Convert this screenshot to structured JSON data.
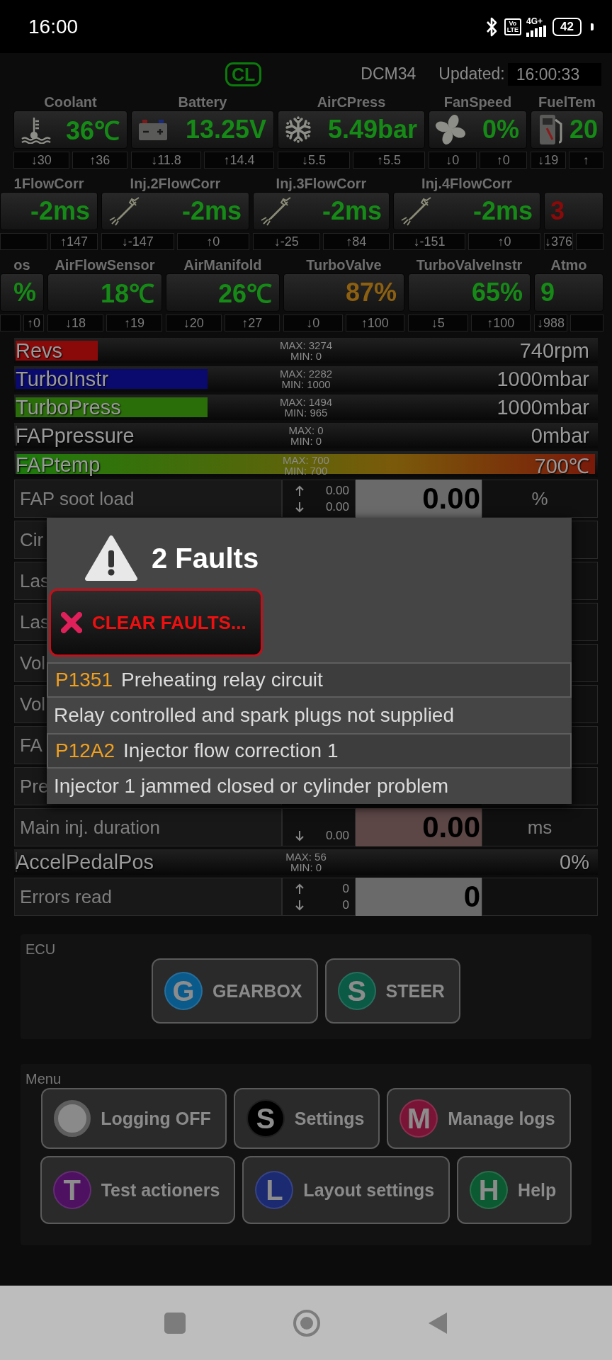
{
  "status_bar": {
    "time": "16:00",
    "volte": [
      "Vo",
      "LTE"
    ],
    "network": "4G+",
    "battery": "42"
  },
  "header": {
    "badge": "CL",
    "module": "DCM34",
    "updated_label": "Updated:",
    "updated_time": "16:00:33"
  },
  "gauge_rows": [
    {
      "tiles": [
        {
          "label": "Coolant",
          "value": "36℃",
          "warning": false,
          "alarm": false,
          "kind": "temperature",
          "min": "↓30",
          "max": "↑36"
        },
        {
          "label": "Battery",
          "value": "13.25V",
          "warning": false,
          "alarm": false,
          "kind": "battery",
          "min": "↓11.8",
          "max": "↑14.4"
        },
        {
          "label": "AirCPress",
          "value": "5.49bar",
          "warning": false,
          "alarm": false,
          "kind": "pressure",
          "min": "↓5.5",
          "max": "↑5.5"
        },
        {
          "label": "FanSpeed",
          "value": "0%",
          "warning": false,
          "alarm": false,
          "kind": "fan",
          "min": "↓0",
          "max": "↑0"
        },
        {
          "label": "FuelTem",
          "value": "20",
          "warning": false,
          "alarm": false,
          "kind": "fuel",
          "min": "↓19",
          "max": "↑"
        }
      ]
    },
    {
      "tiles": [
        {
          "label": "1FlowCorr",
          "value": "-2ms",
          "warning": false,
          "alarm": false,
          "kind": "plain",
          "max": "↑147"
        },
        {
          "label": "Inj.2FlowCorr",
          "value": "-2ms",
          "warning": false,
          "alarm": false,
          "kind": "injector",
          "min": "↓-147",
          "max": "↑0"
        },
        {
          "label": "Inj.3FlowCorr",
          "value": "-2ms",
          "warning": false,
          "alarm": false,
          "kind": "injector",
          "min": "↓-25",
          "max": "↑84"
        },
        {
          "label": "Inj.4FlowCorr",
          "value": "-2ms",
          "warning": false,
          "alarm": false,
          "kind": "injector",
          "min": "↓-151",
          "max": "↑0"
        },
        {
          "value": "3",
          "warning": false,
          "alarm": true,
          "kind": "plain",
          "min": "↓376"
        }
      ]
    },
    {
      "tiles": [
        {
          "label": "os",
          "value": "%",
          "warning": false,
          "alarm": false,
          "kind": "plain",
          "max": "↑0"
        },
        {
          "label": "AirFlowSensor",
          "value": "18℃",
          "warning": false,
          "alarm": false,
          "kind": "plain",
          "min": "↓18",
          "max": "↑19"
        },
        {
          "label": "AirManifold",
          "value": "26℃",
          "warning": false,
          "alarm": false,
          "kind": "plain",
          "min": "↓20",
          "max": "↑27"
        },
        {
          "label": "TurboValve",
          "value": "87%",
          "warning": true,
          "alarm": false,
          "kind": "plain",
          "min": "↓0",
          "max": "↑100"
        },
        {
          "label": "TurboValveInstr",
          "value": "65%",
          "warning": false,
          "alarm": false,
          "kind": "plain",
          "min": "↓5",
          "max": "↑100"
        },
        {
          "label": "Atmo",
          "value": "9",
          "warning": false,
          "alarm": false,
          "kind": "plain",
          "min": "↓988"
        }
      ]
    }
  ],
  "readouts": [
    {
      "kind": "bar",
      "label": "Revs",
      "max": "MAX: 3274",
      "min": "MIN: 0",
      "reading": "740rpm",
      "level": 0.14,
      "color": "#8a0a0a"
    },
    {
      "kind": "bar",
      "label": "TurboInstr",
      "max": "MAX: 2282",
      "min": "MIN: 1000",
      "reading": "1000mbar",
      "level": 0.33,
      "color": "#0a0a6e"
    },
    {
      "kind": "bar",
      "label": "TurboPress",
      "max": "MAX: 1494",
      "min": "MIN: 965",
      "reading": "1000mbar",
      "level": 0.33,
      "color": "#2a6e0a"
    },
    {
      "kind": "bar",
      "label": "FAPpressure",
      "max": "MAX: 0",
      "min": "MIN: 0",
      "reading": "0mbar",
      "level": 0
    },
    {
      "kind": "gradient",
      "label": "FAPtemp",
      "max": "MAX: 700",
      "min": "MIN: 700",
      "reading": "700℃",
      "level": 1
    },
    {
      "kind": "value",
      "label": "FAP soot load",
      "up": "0.00",
      "down": "0.00",
      "value": "0.00",
      "unit": "%",
      "alert": false
    },
    {
      "kind": "value",
      "label": "Cir"
    },
    {
      "kind": "value",
      "label": "Las"
    },
    {
      "kind": "value",
      "label": "Las"
    },
    {
      "kind": "value",
      "label": "Vol"
    },
    {
      "kind": "value",
      "label": "Vol"
    },
    {
      "kind": "value",
      "label": "FA"
    },
    {
      "kind": "value",
      "label": "Pre"
    },
    {
      "kind": "value",
      "label": "Main inj. duration",
      "down": "0.00",
      "value": "0.00",
      "unit": "ms",
      "alert": true
    },
    {
      "kind": "bar",
      "label": "AccelPedalPos",
      "max": "MAX: 56",
      "min": "MIN: 0",
      "reading": "0%",
      "level": 0
    },
    {
      "kind": "value",
      "label": "Errors read",
      "up": "0",
      "down": "0",
      "value": "0",
      "alert": false
    }
  ],
  "dialog": {
    "title": "2 Faults",
    "clear_button": "CLEAR FAULTS...",
    "faults": [
      {
        "code": "P1351",
        "title": "Preheating relay circuit",
        "description": "Relay controlled and spark plugs not supplied"
      },
      {
        "code": "P12A2",
        "title": "Injector flow correction 1",
        "description": "Injector 1 jammed closed or cylinder problem"
      }
    ]
  },
  "ecu": {
    "title": "ECU",
    "rows": [
      [
        {
          "kind": "letter",
          "letter": "G",
          "label": "GEARBOX",
          "color": "#0a5a8c"
        },
        {
          "kind": "letter",
          "letter": "S",
          "label": "STEER",
          "color": "#0a5a46"
        }
      ]
    ]
  },
  "menu": {
    "title": "Menu",
    "rows": [
      [
        {
          "kind": "toggle",
          "label": "Logging OFF",
          "on": false
        },
        {
          "kind": "letter",
          "letter": "S",
          "label": "Settings",
          "color": "#000000"
        },
        {
          "kind": "letter",
          "letter": "M",
          "label": "Manage logs",
          "color": "#7a1436"
        }
      ],
      [
        {
          "kind": "letter",
          "letter": "T",
          "label": "Test actioners",
          "color": "#4e1060"
        },
        {
          "kind": "letter",
          "letter": "L",
          "label": "Layout settings",
          "color": "#1c2a72"
        },
        {
          "kind": "letter",
          "letter": "H",
          "label": "Help",
          "color": "#0c5a32"
        }
      ]
    ]
  }
}
